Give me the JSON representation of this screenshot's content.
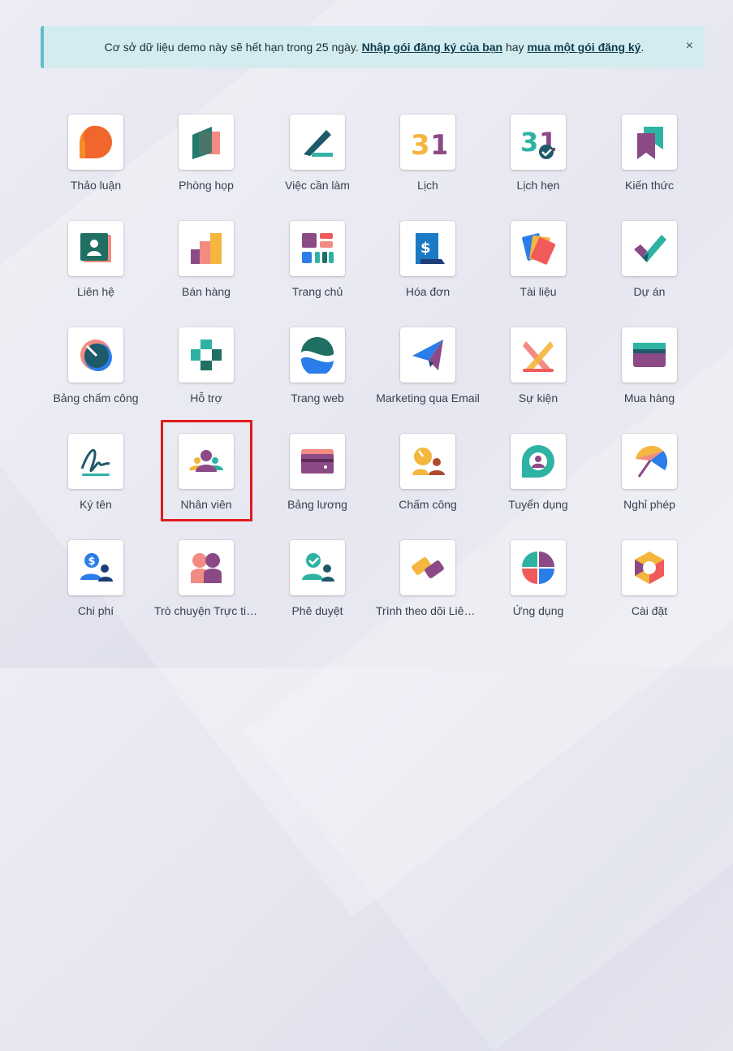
{
  "banner": {
    "text_before": "Cơ sở dữ liệu demo này sẽ hết hạn trong 25 ngày. ",
    "link1": "Nhập gói đăng ký của bạn",
    "text_middle": " hay ",
    "link2": "mua một gói đăng ký",
    "text_after": ".",
    "close": "×"
  },
  "apps": [
    {
      "label": "Thảo luận",
      "icon": "discuss-icon"
    },
    {
      "label": "Phòng họp",
      "icon": "meeting-room-icon"
    },
    {
      "label": "Việc cần làm",
      "icon": "todo-icon"
    },
    {
      "label": "Lịch",
      "icon": "calendar-icon"
    },
    {
      "label": "Lịch hẹn",
      "icon": "appointment-icon"
    },
    {
      "label": "Kiến thức",
      "icon": "knowledge-icon"
    },
    {
      "label": "Liên hệ",
      "icon": "contacts-icon"
    },
    {
      "label": "Bán hàng",
      "icon": "sales-icon"
    },
    {
      "label": "Trang chủ",
      "icon": "dashboard-icon"
    },
    {
      "label": "Hóa đơn",
      "icon": "invoice-icon"
    },
    {
      "label": "Tài liệu",
      "icon": "documents-icon"
    },
    {
      "label": "Dự án",
      "icon": "project-icon"
    },
    {
      "label": "Bảng chấm công",
      "icon": "timesheet-icon"
    },
    {
      "label": "Hỗ trợ",
      "icon": "helpdesk-icon"
    },
    {
      "label": "Trang web",
      "icon": "website-icon"
    },
    {
      "label": "Marketing qua Email",
      "icon": "email-marketing-icon"
    },
    {
      "label": "Sự kiện",
      "icon": "events-icon"
    },
    {
      "label": "Mua hàng",
      "icon": "purchase-icon"
    },
    {
      "label": "Ký tên",
      "icon": "sign-icon"
    },
    {
      "label": "Nhân viên",
      "icon": "employees-icon"
    },
    {
      "label": "Bảng lương",
      "icon": "payroll-icon"
    },
    {
      "label": "Chấm công",
      "icon": "attendance-icon"
    },
    {
      "label": "Tuyển dụng",
      "icon": "recruitment-icon"
    },
    {
      "label": "Nghỉ phép",
      "icon": "time-off-icon"
    },
    {
      "label": "Chi phí",
      "icon": "expenses-icon"
    },
    {
      "label": "Trò chuyện Trực tiếp",
      "icon": "live-chat-icon"
    },
    {
      "label": "Phê duyệt",
      "icon": "approvals-icon"
    },
    {
      "label": "Trình theo dõi Liên kết",
      "icon": "link-tracker-icon"
    },
    {
      "label": "Ứng dụng",
      "icon": "apps-icon"
    },
    {
      "label": "Cài đặt",
      "icon": "settings-icon"
    }
  ],
  "colors": {
    "banner_bg": "#d3ecef",
    "highlight": "#e01b1b"
  }
}
